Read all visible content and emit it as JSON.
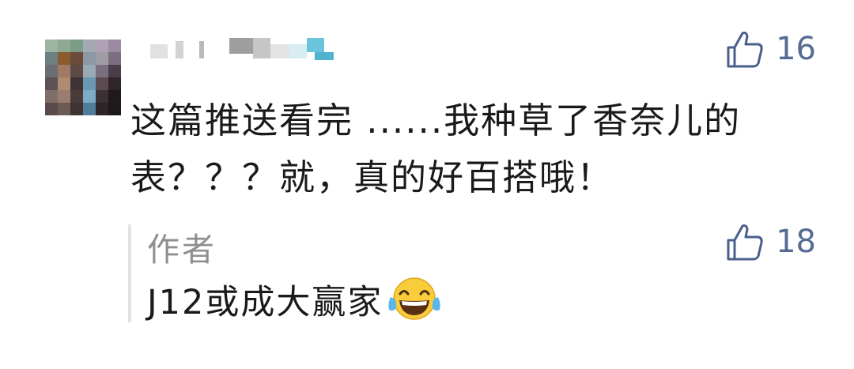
{
  "comment": {
    "avatar_colors": [
      "#9fb5a4",
      "#8ea893",
      "#7b9c88",
      "#a4aab2",
      "#b0a2b6",
      "#9b8aa1",
      "#6d7f83",
      "#8a5b2e",
      "#6a4a3b",
      "#8d98a4",
      "#a09ca6",
      "#7c6d80",
      "#6b6e73",
      "#a07a64",
      "#5d4a45",
      "#9aa9b6",
      "#7a6f7e",
      "#4b3d48",
      "#5e5255",
      "#b18a72",
      "#3f3234",
      "#6a98b4",
      "#5c4a52",
      "#2f2529",
      "#7f6f6a",
      "#9a7d70",
      "#4a3b3b",
      "#7eaac8",
      "#3b3033",
      "#1f1a1d",
      "#5a4a49",
      "#6c5a55",
      "#3d3234",
      "#4e7d9a",
      "#2d2427",
      "#1c181b"
    ],
    "text": "这篇推送看完 ......我种草了香奈儿的表？？？就，真的好百搭哦！",
    "like_count": "16"
  },
  "reply": {
    "author": "作者",
    "text": "J12或成大赢家",
    "emoji": "face-with-tears-of-joy-icon",
    "like_count": "18"
  },
  "colors": {
    "like_icon": "#4a5f8c",
    "author": "#8f8f8f",
    "text": "#1a1a1a"
  }
}
